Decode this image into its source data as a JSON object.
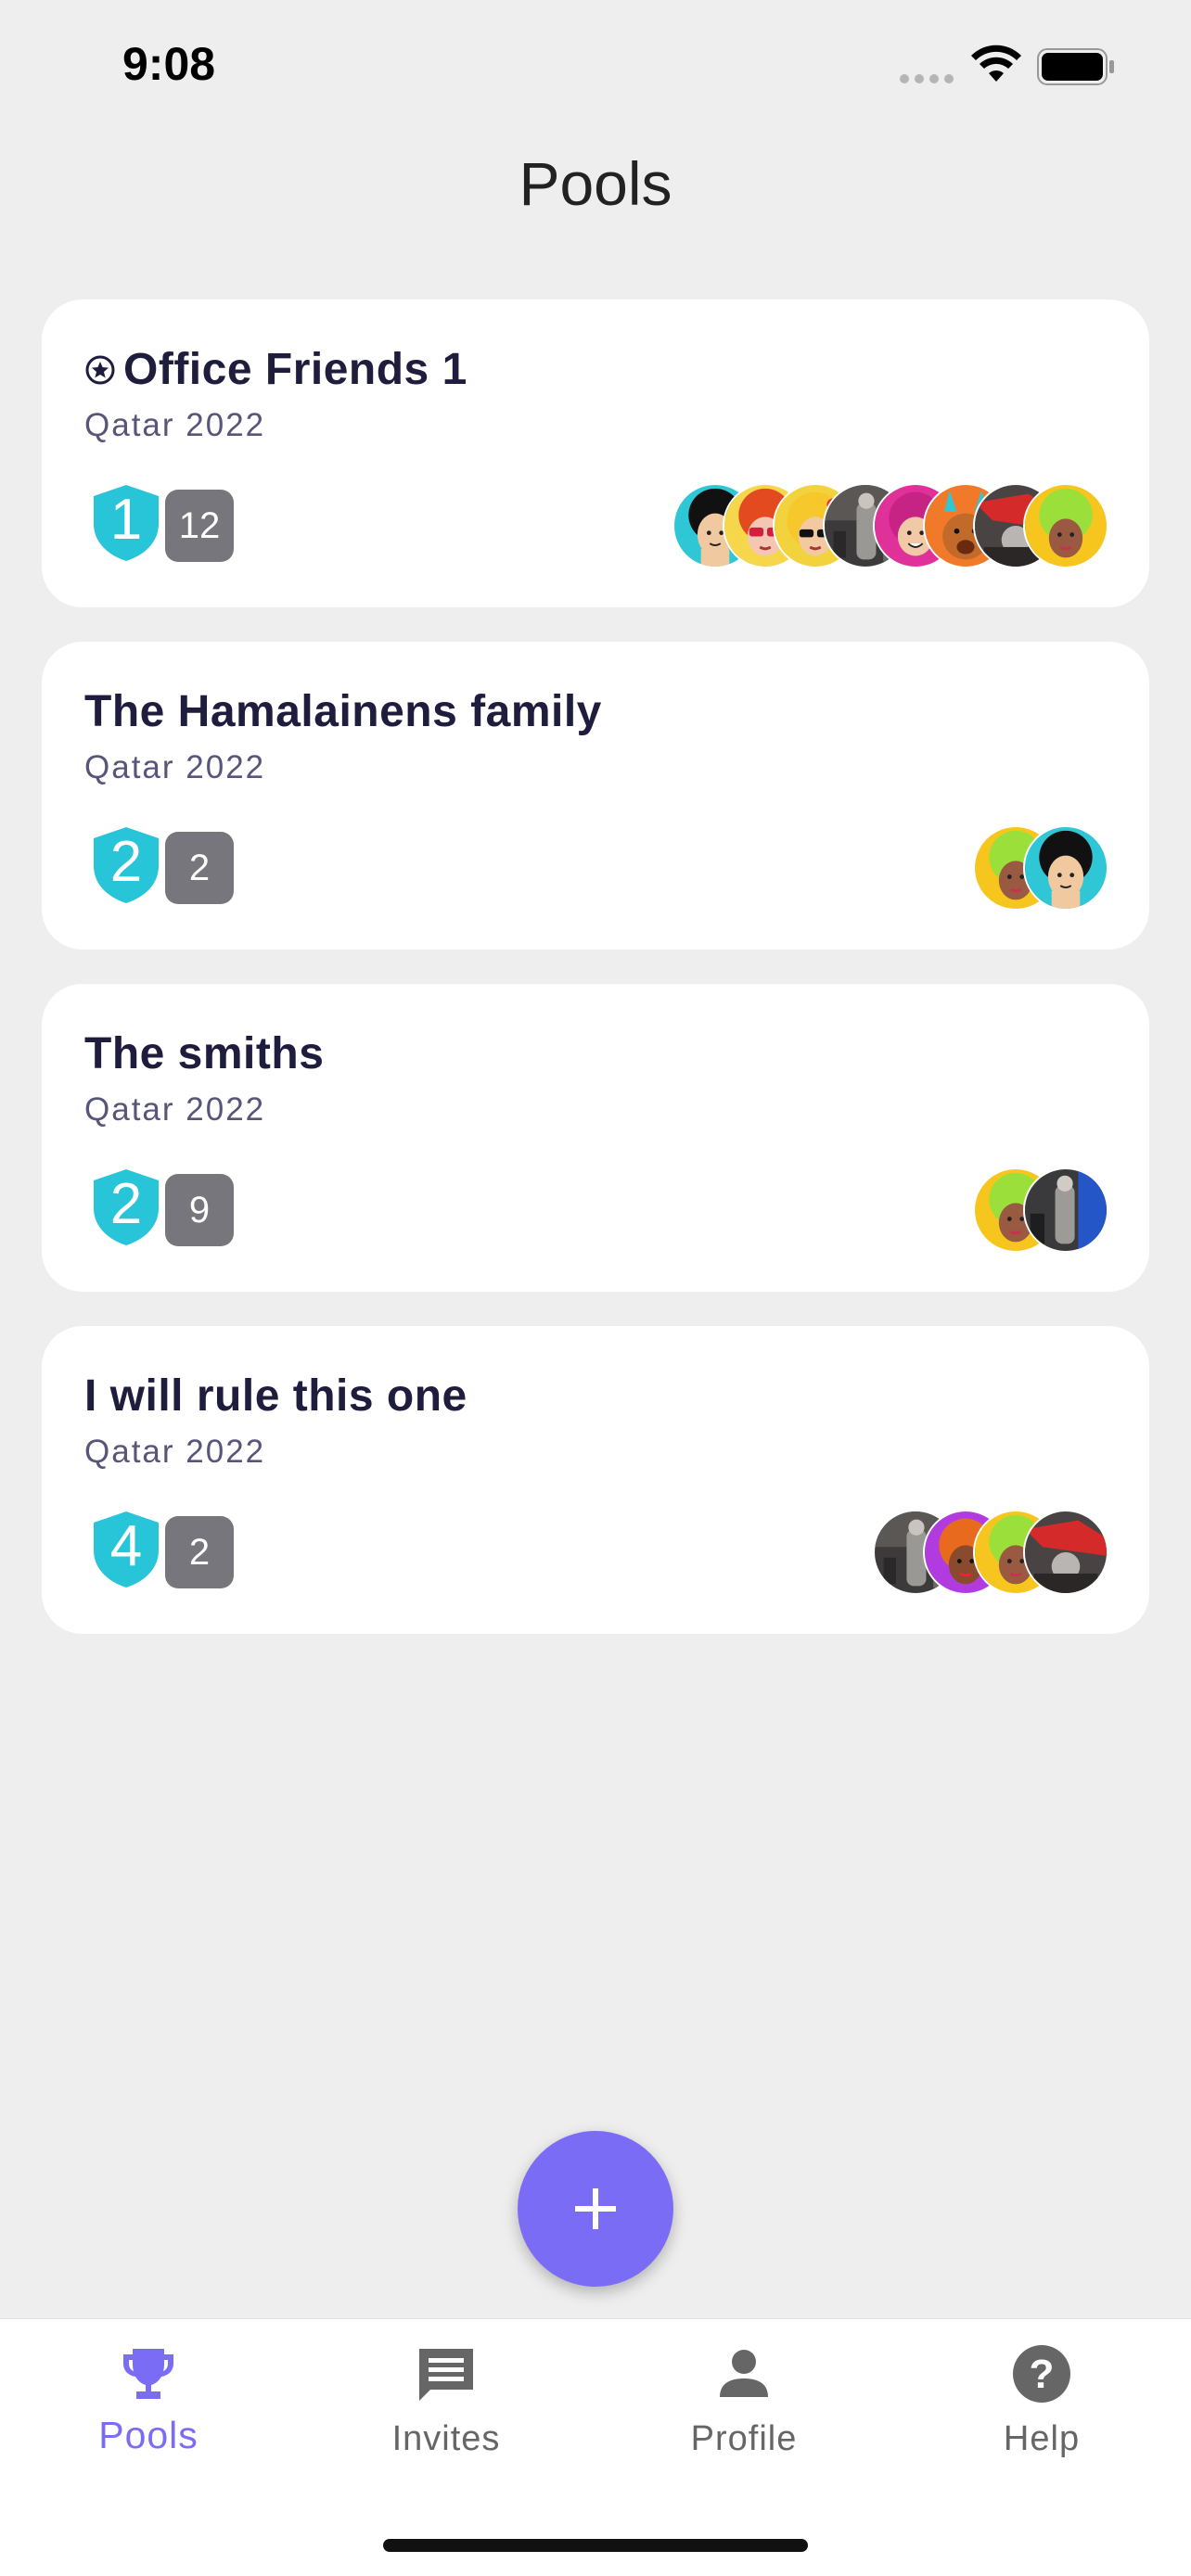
{
  "status_bar": {
    "time": "9:08"
  },
  "header": {
    "title": "Pools"
  },
  "pools": [
    {
      "name": "Office Friends 1",
      "featured": true,
      "event": "Qatar 2022",
      "rank": "1",
      "count": "12",
      "avatars": [
        "afro-boy",
        "red-hair-glasses",
        "sunglasses-girl",
        "photo-dark",
        "pink-girl",
        "orange-bear",
        "photo-red",
        "green-hair"
      ]
    },
    {
      "name": "The Hamalainens family",
      "featured": false,
      "event": "Qatar 2022",
      "rank": "2",
      "count": "2",
      "avatars": [
        "green-hair",
        "afro-boy"
      ]
    },
    {
      "name": "The smiths",
      "featured": false,
      "event": "Qatar 2022",
      "rank": "2",
      "count": "9",
      "avatars": [
        "green-hair",
        "photo-blue"
      ]
    },
    {
      "name": "I will rule this one",
      "featured": false,
      "event": "Qatar 2022",
      "rank": "4",
      "count": "2",
      "avatars": [
        "photo-dark",
        "purple-orange",
        "green-hair",
        "photo-red"
      ]
    }
  ],
  "fab": {
    "icon": "plus-icon"
  },
  "nav": {
    "items": [
      {
        "label": "Pools",
        "icon": "trophy-icon",
        "active": true
      },
      {
        "label": "Invites",
        "icon": "chat-icon",
        "active": false
      },
      {
        "label": "Profile",
        "icon": "person-icon",
        "active": false
      },
      {
        "label": "Help",
        "icon": "help-icon",
        "active": false
      }
    ]
  },
  "colors": {
    "accent": "#7b6cf6",
    "shield": "#28c4d8",
    "badge": "#77767c",
    "title": "#1f1d3d"
  }
}
